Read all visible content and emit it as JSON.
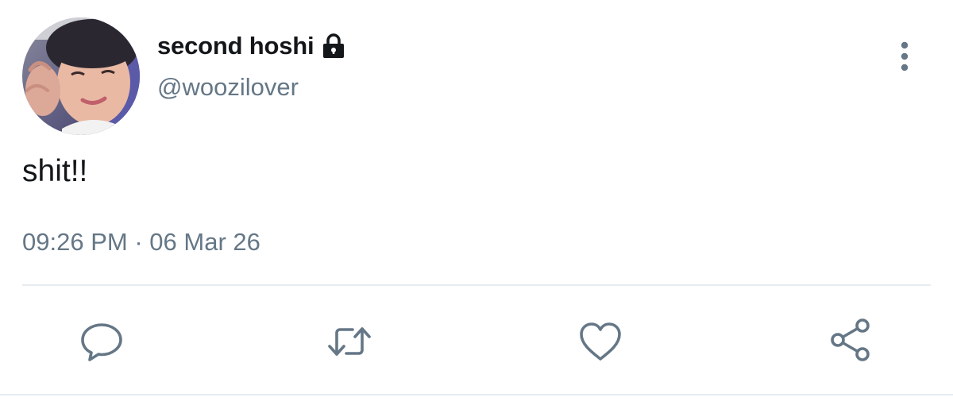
{
  "user": {
    "display_name": "second hoshi",
    "handle": "@woozilover",
    "protected_icon": "lock-icon"
  },
  "tweet": {
    "text": "shit!!",
    "time": "09:26 PM",
    "separator": "·",
    "date": "06 Mar 26"
  },
  "actions": [
    {
      "name": "reply",
      "icon": "speech-bubble-icon"
    },
    {
      "name": "retweet",
      "icon": "retweet-arrows-icon"
    },
    {
      "name": "like",
      "icon": "heart-icon"
    },
    {
      "name": "share",
      "icon": "share-nodes-icon"
    }
  ],
  "colors": {
    "primary_text": "#14171a",
    "secondary_text": "#657786",
    "icon": "#657786",
    "divider": "#e6ecf0"
  }
}
